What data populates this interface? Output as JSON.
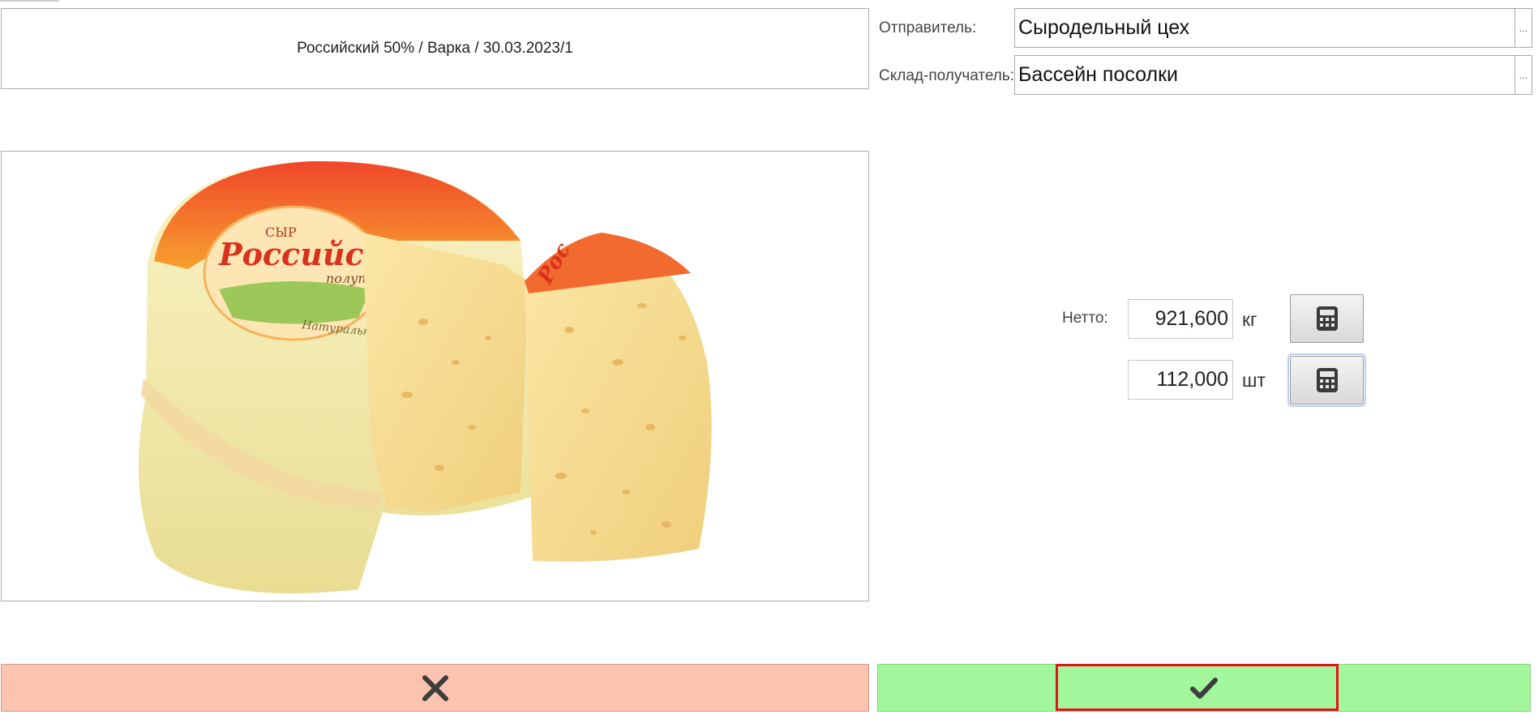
{
  "header": {
    "batch_title": "Российский 50% / Варка / 30.03.2023/1"
  },
  "form": {
    "sender_label": "Отправитель:",
    "sender_value": "Сыродельный цех",
    "warehouse_label": "Склад-получатель:",
    "warehouse_value": "Бассейн посолки",
    "picker_glyph": "..."
  },
  "product_image": {
    "label_top": "СЫР",
    "label_brand": "Российск",
    "label_sub": "полутв",
    "label_bottom": "Натуральный вку",
    "wedge_text": "Рос"
  },
  "quantities": {
    "netto_label": "Нетто:",
    "weight_value": "921,600",
    "weight_unit": "кг",
    "count_value": "112,000",
    "count_unit": "шт"
  },
  "actions": {
    "cancel_icon": "close-icon",
    "confirm_icon": "checkmark-icon"
  },
  "colors": {
    "cancel_bg": "#fcc4ae",
    "confirm_bg": "#a2f79c",
    "highlight": "#e31414"
  }
}
